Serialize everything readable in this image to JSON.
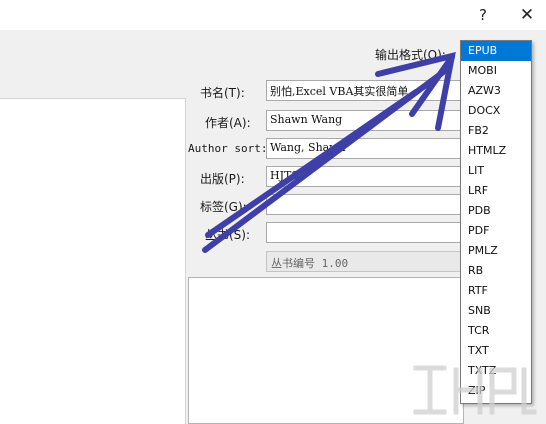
{
  "titlebar": {
    "help": "?",
    "close": "✕"
  },
  "form": {
    "output_format_label": "输出格式(O):",
    "title_label": "书名(T):",
    "title_value": "别怕,Excel VBA其实很简单",
    "author_label": "作者(A):",
    "author_value": "Shawn Wang",
    "author_sort_label": "Author sort:",
    "author_sort_value": "Wang, Shawn",
    "publisher_label": "出版(P):",
    "publisher_value": "HJTS",
    "tags_label": "标签(G):",
    "tags_value": "",
    "series_label": "丛书(S):",
    "series_value": "",
    "series_number": "丛书编号 1.00"
  },
  "format_list": {
    "selected": "EPUB",
    "items": [
      "EPUB",
      "MOBI",
      "AZW3",
      "DOCX",
      "FB2",
      "HTMLZ",
      "LIT",
      "LRF",
      "PDB",
      "PDF",
      "PMLZ",
      "RB",
      "RTF",
      "SNB",
      "TCR",
      "TXT",
      "TXTZ",
      "ZIP"
    ]
  },
  "colors": {
    "selection": "#0078d7",
    "annotation_arrow": "#3f3fa8"
  }
}
